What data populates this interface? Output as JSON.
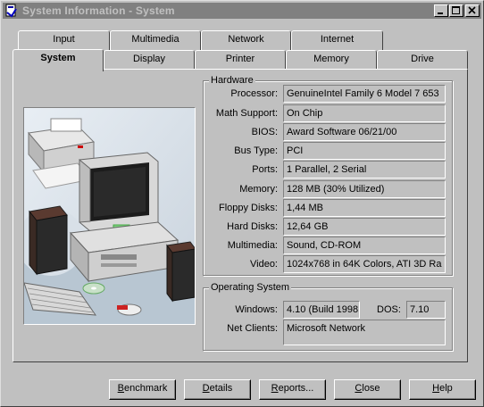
{
  "window": {
    "title": "System Information - System"
  },
  "title_buttons": {
    "minimize": "_",
    "maximize": "□",
    "close": "×"
  },
  "tabs_back": [
    "Input",
    "Multimedia",
    "Network",
    "Internet"
  ],
  "tabs_front": [
    "System",
    "Display",
    "Printer",
    "Memory",
    "Drive"
  ],
  "active_tab": "System",
  "hardware": {
    "label": "Hardware",
    "rows": [
      {
        "label": "Processor:",
        "value": "GenuineIntel Family 6 Model 7 653"
      },
      {
        "label": "Math Support:",
        "value": "On Chip"
      },
      {
        "label": "BIOS:",
        "value": "Award Software 06/21/00"
      },
      {
        "label": "Bus Type:",
        "value": "PCI"
      },
      {
        "label": "Ports:",
        "value": "1 Parallel, 2 Serial"
      },
      {
        "label": "Memory:",
        "value": "128 MB  (30% Utilized)"
      },
      {
        "label": "Floppy Disks:",
        "value": "1,44 MB"
      },
      {
        "label": "Hard Disks:",
        "value": "12,64 GB"
      },
      {
        "label": "Multimedia:",
        "value": "Sound, CD-ROM"
      },
      {
        "label": "Video:",
        "value": "1024x768 in 64K Colors, ATI 3D Ra"
      }
    ]
  },
  "os": {
    "label": "Operating System",
    "windows_label": "Windows:",
    "windows_value": "4.10 (Build 1998",
    "dos_label": "DOS:",
    "dos_value": "7.10",
    "net_label": "Net Clients:",
    "net_value": "Microsoft Network"
  },
  "buttons": [
    {
      "name": "benchmark-button",
      "u": "B",
      "rest": "enchmark"
    },
    {
      "name": "details-button",
      "u": "D",
      "rest": "etails"
    },
    {
      "name": "reports-button",
      "u": "R",
      "rest": "eports..."
    },
    {
      "name": "close-button",
      "u": "C",
      "rest": "lose"
    },
    {
      "name": "help-button",
      "u": "H",
      "rest": "elp"
    }
  ],
  "colors": {
    "titlebar": "#808080",
    "face": "#c0c0c0",
    "title_text": "#c0c0c0"
  },
  "illustration": {
    "icon": "computer-system-illustration"
  }
}
